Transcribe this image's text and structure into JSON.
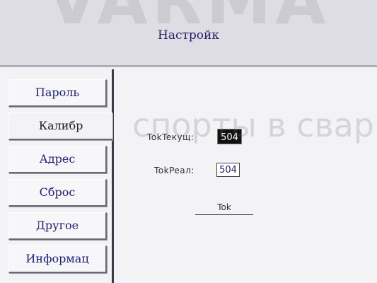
{
  "watermark": {
    "top": "VARMA",
    "middle": "спорты в свар"
  },
  "header": {
    "title": "Настройк"
  },
  "sidebar": {
    "items": [
      {
        "label": "Пароль",
        "active": false
      },
      {
        "label": "Калибр",
        "active": true
      },
      {
        "label": "Адрес",
        "active": false
      },
      {
        "label": "Сброс",
        "active": false
      },
      {
        "label": "Другое",
        "active": false
      },
      {
        "label": "Информац",
        "active": false
      }
    ]
  },
  "calibration": {
    "current_label": "TokTeкущ:",
    "current_value": "504",
    "real_label": "TokPeaл:",
    "real_value": "504",
    "button_label": "Tok"
  },
  "colors": {
    "header_bg": "#dfdde4",
    "text_blue": "#1f1f70",
    "highlight_bg": "#111111"
  }
}
